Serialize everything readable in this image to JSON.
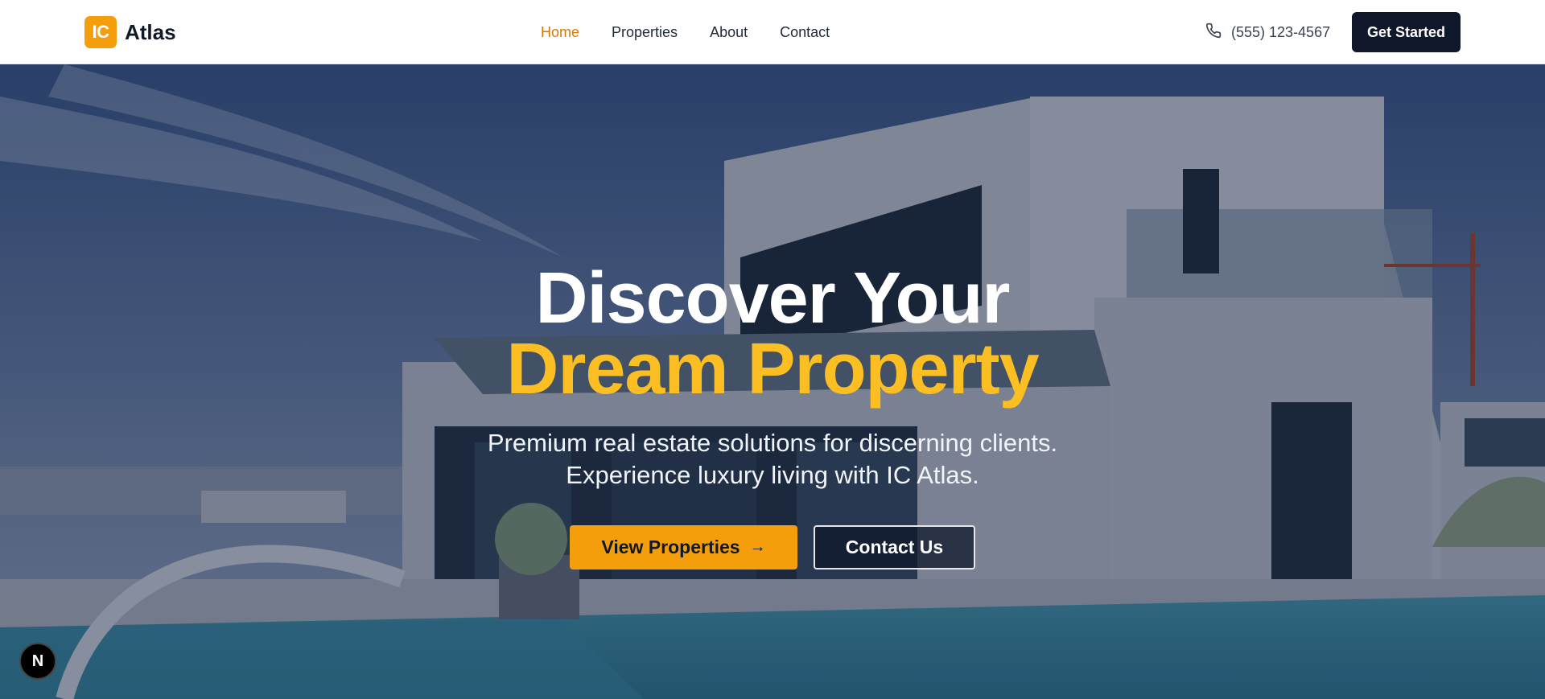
{
  "brand": {
    "badge": "IC",
    "name": "Atlas"
  },
  "nav": [
    {
      "label": "Home",
      "active": true
    },
    {
      "label": "Properties",
      "active": false
    },
    {
      "label": "About",
      "active": false
    },
    {
      "label": "Contact",
      "active": false
    }
  ],
  "header": {
    "phone": "(555) 123-4567",
    "cta": "Get Started"
  },
  "hero": {
    "title_line1": "Discover Your",
    "title_line2": "Dream Property",
    "subtitle_line1": "Premium real estate solutions for discerning clients.",
    "subtitle_line2": "Experience luxury living with IC Atlas.",
    "primary_button": "View Properties",
    "secondary_button": "Contact Us"
  },
  "dev_badge": "N",
  "colors": {
    "accent": "#f59e0b",
    "accent_text": "#fbbf24",
    "nav_active": "#d97706",
    "dark": "#0f172a"
  }
}
